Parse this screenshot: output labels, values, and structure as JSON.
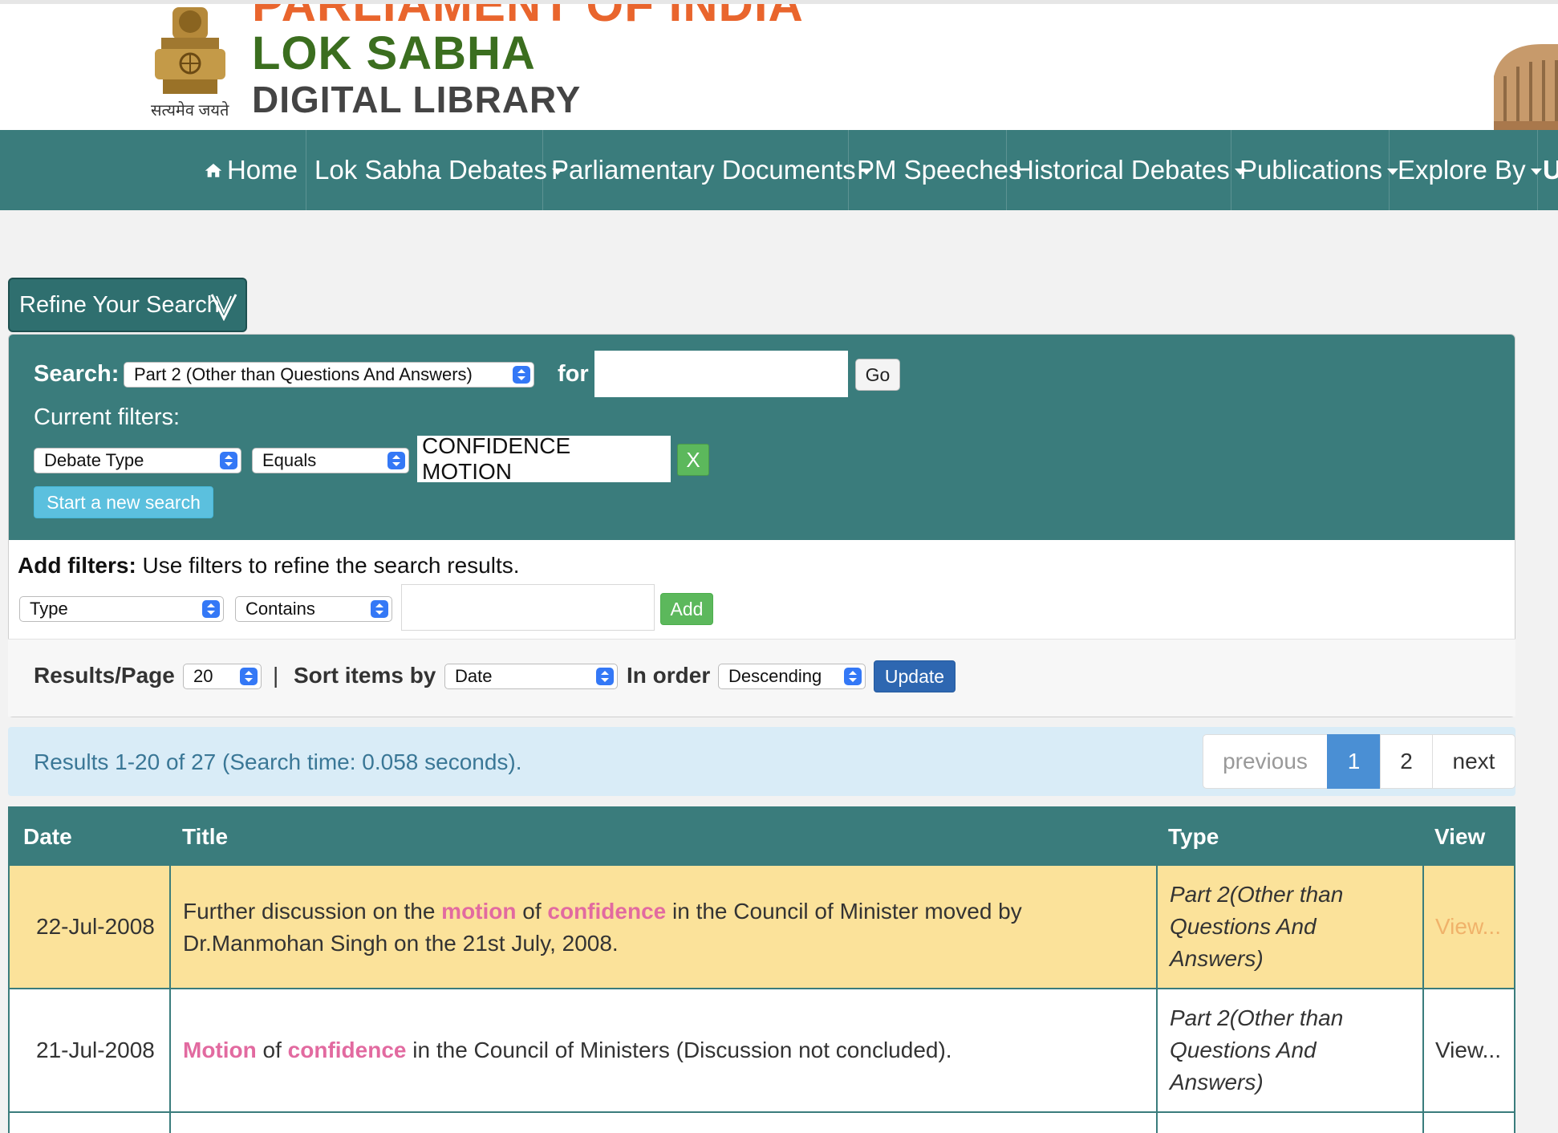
{
  "header": {
    "emblem_motto": "सत्यमेव जयते",
    "brand_line_top": "PARLIAMENT OF INDIA",
    "brand_line_main": "LOK SABHA",
    "brand_line_sub": "DIGITAL LIBRARY"
  },
  "nav": {
    "items": [
      {
        "label": "Home",
        "icon": "home-icon",
        "dropdown": false
      },
      {
        "label": "Lok Sabha Debates",
        "dropdown": true
      },
      {
        "label": "Parliamentary Documents",
        "dropdown": true
      },
      {
        "label": "PM Speeches",
        "dropdown": false
      },
      {
        "label": "Historical Debates",
        "dropdown": true
      },
      {
        "label": "Publications",
        "dropdown": true
      },
      {
        "label": "Explore By",
        "dropdown": true
      },
      {
        "label": "U",
        "dropdown": false
      }
    ]
  },
  "refine": {
    "toggle_label": "Refine Your Search"
  },
  "search": {
    "label": "Search:",
    "scope_selected": "Part 2 (Other than Questions And Answers)",
    "for_label": "for",
    "query_value": "",
    "go_label": "Go",
    "current_filters_label": "Current filters:",
    "filter_field": "Debate Type",
    "filter_operator": "Equals",
    "filter_value": "CONFIDENCE MOTION",
    "remove_label": "X",
    "new_search_label": "Start a new search"
  },
  "add_filters": {
    "bold_label": "Add filters:",
    "hint": " Use filters to refine the search results.",
    "field_selected": "Type",
    "operator_selected": "Contains",
    "value": "",
    "add_label": "Add"
  },
  "paging_controls": {
    "results_per_page_label": "Results/Page",
    "results_per_page": "20",
    "separator": "|",
    "sort_label": "Sort items by",
    "sort_selected": "Date",
    "order_label": "In order",
    "order_selected": "Descending",
    "update_label": "Update"
  },
  "results": {
    "summary": "Results 1-20 of 27 (Search time: 0.058 seconds).",
    "pagination": {
      "previous": "previous",
      "pages": [
        "1",
        "2"
      ],
      "current": "1",
      "next": "next"
    }
  },
  "table": {
    "headers": {
      "date": "Date",
      "title": "Title",
      "type": "Type",
      "view": "View"
    },
    "rows": [
      {
        "date": "22-Jul-2008",
        "title_parts": [
          {
            "text": "Further discussion on the ",
            "hl": false
          },
          {
            "text": "motion",
            "hl": true
          },
          {
            "text": " of ",
            "hl": false
          },
          {
            "text": "confidence",
            "hl": true
          },
          {
            "text": " in the Council of Minister moved by Dr.Manmohan Singh on the 21st July, 2008.",
            "hl": false
          }
        ],
        "type": "Part 2(Other than Questions And Answers)",
        "view": "View...",
        "highlighted": true
      },
      {
        "date": "21-Jul-2008",
        "title_parts": [
          {
            "text": "Motion",
            "hl": true
          },
          {
            "text": " of ",
            "hl": false
          },
          {
            "text": "confidence",
            "hl": true
          },
          {
            "text": " in the Council of Ministers (Discussion not concluded).",
            "hl": false
          }
        ],
        "type": "Part 2(Other than Questions And Answers)",
        "view": "View...",
        "highlighted": false
      }
    ]
  },
  "colors": {
    "nav_teal": "#3a7c7c",
    "highlight_row": "#fbe29a",
    "search_hit_pink": "#e26aa0",
    "active_page_blue": "#4a8fd4",
    "brand_green": "#3b6e1f",
    "brand_orange": "#e9652d"
  }
}
